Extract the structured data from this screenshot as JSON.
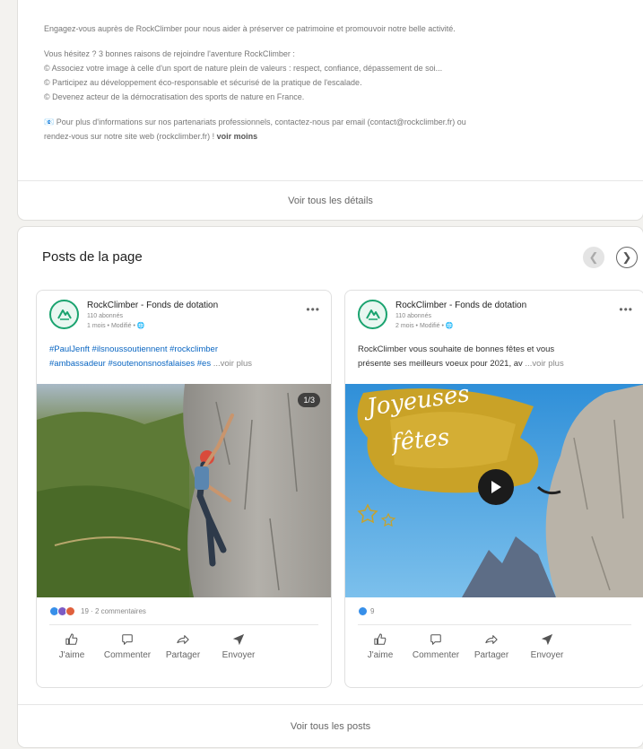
{
  "about": {
    "paragraph_1": "Engagez-vous auprès de RockClimber pour nous aider à préserver ce patrimoine et promouvoir notre belle activité.",
    "reasons_title": "Vous hésitez ? 3 bonnes raisons de rejoindre l'aventure RockClimber :",
    "reasons": [
      "© Associez votre image à celle d'un sport de nature plein de valeurs : respect, confiance, dépassement de soi...",
      "© Participez au développement éco-responsable et sécurisé de la pratique de l'escalade.",
      "© Devenez acteur de la démocratisation des sports de nature en France."
    ],
    "contact_line_1": "📧 Pour plus d'informations sur nos partenariats professionnels, contactez-nous par email (contact@rockclimber.fr) ou",
    "contact_line_2": "rendez-vous sur notre site web (rockclimber.fr) !",
    "voir_moins": "voir moins",
    "details_link": "Voir tous les détails"
  },
  "posts": {
    "title": "Posts de la page",
    "footer_link": "Voir tous les posts",
    "items": [
      {
        "author": "RockClimber - Fonds de dotation",
        "followers": "110 abonnés",
        "meta": "1 mois • Modifié •",
        "text_line_1": "#PaulJenft #ilsnoussoutiennent #rockclimber",
        "text_line_2": "#ambassadeur #soutenonsnosfalaises #es",
        "see_more": "...voir plus",
        "counter": "1/3",
        "reactions_text": "19 · 2 commentaires"
      },
      {
        "author": "RockClimber - Fonds de dotation",
        "followers": "110 abonnés",
        "meta": "2 mois • Modifié •",
        "text_line_1": "RockClimber vous souhaite de bonnes fêtes et vous",
        "text_line_2": "présente ses meilleurs voeux pour 2021, av",
        "see_more": "...voir plus",
        "image_caption_1": "Joyeuses",
        "image_caption_2": "fêtes",
        "reactions_text": "9"
      }
    ],
    "actions": {
      "like": "J'aime",
      "comment": "Commenter",
      "share": "Partager",
      "send": "Envoyer"
    }
  },
  "colors": {
    "brand_green": "#1aa36f",
    "link_blue": "#0a66c2",
    "gold": "#c9a227"
  }
}
